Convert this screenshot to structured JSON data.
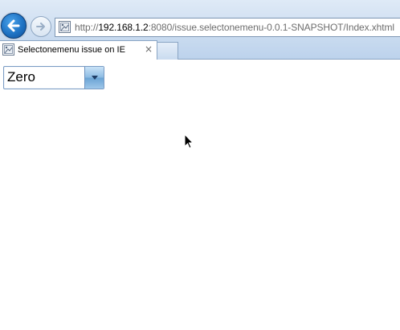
{
  "browser": {
    "address": {
      "url_prefix": "http://",
      "url_host": "192.168.1.2",
      "url_rest": ":8080/issue.selectonemenu-0.0.1-SNAPSHOT/Index.xhtml"
    },
    "tab": {
      "title": "Selectonemenu issue on IE",
      "close_glyph": "×"
    },
    "icons": {
      "back": "back-arrow-icon",
      "forward": "forward-arrow-icon",
      "page": "page-icon",
      "close": "close-icon",
      "dropdown": "chevron-down-icon",
      "cursor": "mouse-pointer-icon"
    }
  },
  "page": {
    "select": {
      "selected": "Zero"
    }
  },
  "colors": {
    "chrome_top": "#dfeaf7",
    "chrome_bottom": "#bcd2ec",
    "back_button": "#1f73c4",
    "select_border": "#7a9cc4",
    "select_button": "#8cbbe3"
  }
}
